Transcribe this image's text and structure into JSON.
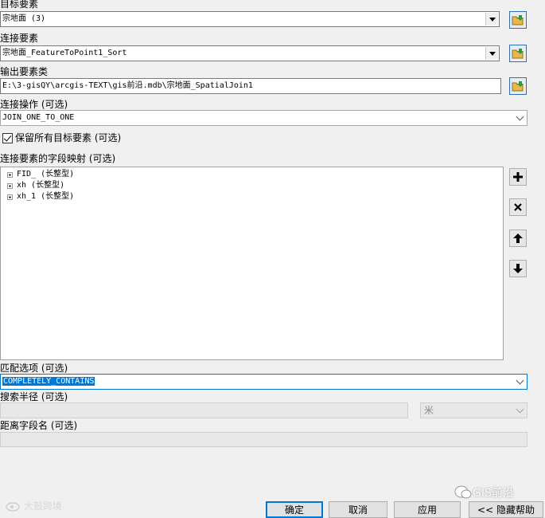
{
  "fields": {
    "target_label": "目标要素",
    "target_value": "宗地面 (3)",
    "join_label": "连接要素",
    "join_value": "宗地面_FeatureToPoint1_Sort",
    "output_label": "输出要素类",
    "output_value": "E:\\3-gisQY\\arcgis-TEXT\\gis前沿.mdb\\宗地面_SpatialJoin1",
    "operation_label": "连接操作 (可选)",
    "operation_value": "JOIN_ONE_TO_ONE",
    "keep_all_label": "保留所有目标要素 (可选)",
    "keep_all_checked": true,
    "field_map_label": "连接要素的字段映射 (可选)",
    "field_map_items": [
      "FID_ (长整型)",
      "xh (长整型)",
      "xh_1 (长整型)"
    ],
    "match_label": "匹配选项 (可选)",
    "match_value": "COMPLETELY_CONTAINS",
    "radius_label": "搜索半径 (可选)",
    "radius_unit": "米",
    "distance_label": "距离字段名 (可选)"
  },
  "side_buttons": [
    "add-icon",
    "remove-icon",
    "up-arrow-icon",
    "down-arrow-icon"
  ],
  "buttons": {
    "ok": "确定",
    "cancel": "取消",
    "apply": "应用",
    "hide_help": "<< 隐藏帮助"
  },
  "watermarks": {
    "left": "大鼓跨境",
    "right": "GIS前沿"
  },
  "colors": {
    "accent": "#0078d7",
    "folder_border": "#2f6fb8",
    "folder_fill": "#e8b84a"
  }
}
